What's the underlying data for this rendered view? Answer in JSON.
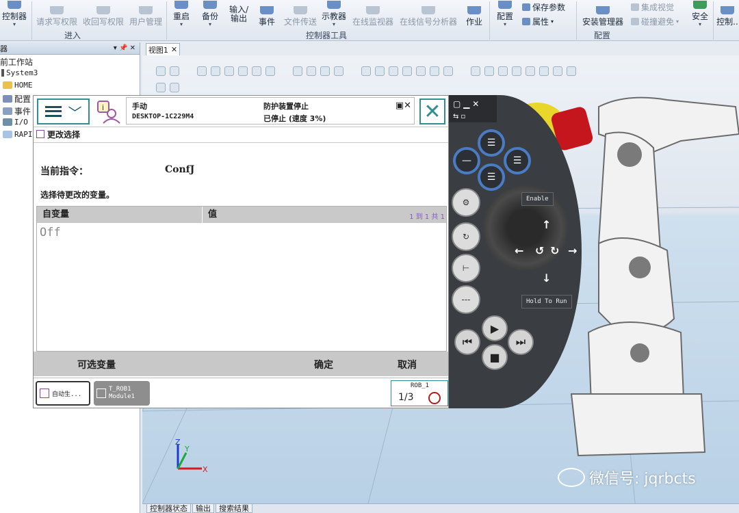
{
  "ribbon": {
    "buttons": [
      {
        "label": "控制器",
        "disabled": false
      },
      {
        "label": "请求写权限",
        "disabled": true
      },
      {
        "label": "收回写权限",
        "disabled": true
      },
      {
        "label": "用户管理",
        "disabled": true
      },
      {
        "label": "重启",
        "disabled": false
      },
      {
        "label": "备份",
        "disabled": false
      },
      {
        "label": "输入/\n输出",
        "disabled": false
      },
      {
        "label": "事件",
        "disabled": false
      },
      {
        "label": "文件传送",
        "disabled": true
      },
      {
        "label": "示教器",
        "disabled": false
      },
      {
        "label": "在线监视器",
        "disabled": true
      },
      {
        "label": "在线信号分析器",
        "disabled": true
      },
      {
        "label": "作业",
        "disabled": false
      },
      {
        "label": "配置",
        "disabled": false
      },
      {
        "label": "安装管理器",
        "disabled": false
      },
      {
        "label": "安全",
        "disabled": false
      },
      {
        "label": "控制..",
        "disabled": false
      }
    ],
    "small_buttons": [
      {
        "label": "保存参数",
        "disabled": false
      },
      {
        "label": "属性",
        "disabled": false
      },
      {
        "label": "集成视觉",
        "disabled": true
      },
      {
        "label": "碰撞避免",
        "disabled": true
      }
    ],
    "groups": [
      "进入",
      "控制器工具",
      "配置"
    ]
  },
  "tree": {
    "header": "器",
    "items": [
      "前工作站",
      "System3",
      "HOME",
      "配置",
      "事件",
      "I/O",
      "RAPI"
    ]
  },
  "view": {
    "tab_label": "视图1",
    "status_tabs": [
      "控制器状态",
      "输出",
      "搜索结果"
    ]
  },
  "pendant": {
    "mode": "手动",
    "host": "DESKTOP-1C229M4",
    "guard": "防护装置停止",
    "state": "已停止 (速度 3%)",
    "title": "更改选择",
    "current_instr_label": "当前指令：",
    "current_instr_value": "ConfJ",
    "prompt": "选择待更改的变量。",
    "table": {
      "col1": "自变量",
      "col2": "值",
      "paging": "1 到 1 共 1",
      "rows": [
        {
          "arg": "Off"
        }
      ]
    },
    "cmd": {
      "optional": "可选变量",
      "ok": "确定",
      "cancel": "取消"
    },
    "task1": "自动生...",
    "task2_line1": "T_ROB1",
    "task2_line2": "Module1",
    "rob": "ROB_1",
    "rob_frac": "1/3"
  },
  "jog": {
    "enable": "Enable",
    "hold": "Hold To Run"
  },
  "axis_labels": {
    "x": "X",
    "y": "Y",
    "z": "Z"
  },
  "watermark": "微信号: jqrbcts"
}
